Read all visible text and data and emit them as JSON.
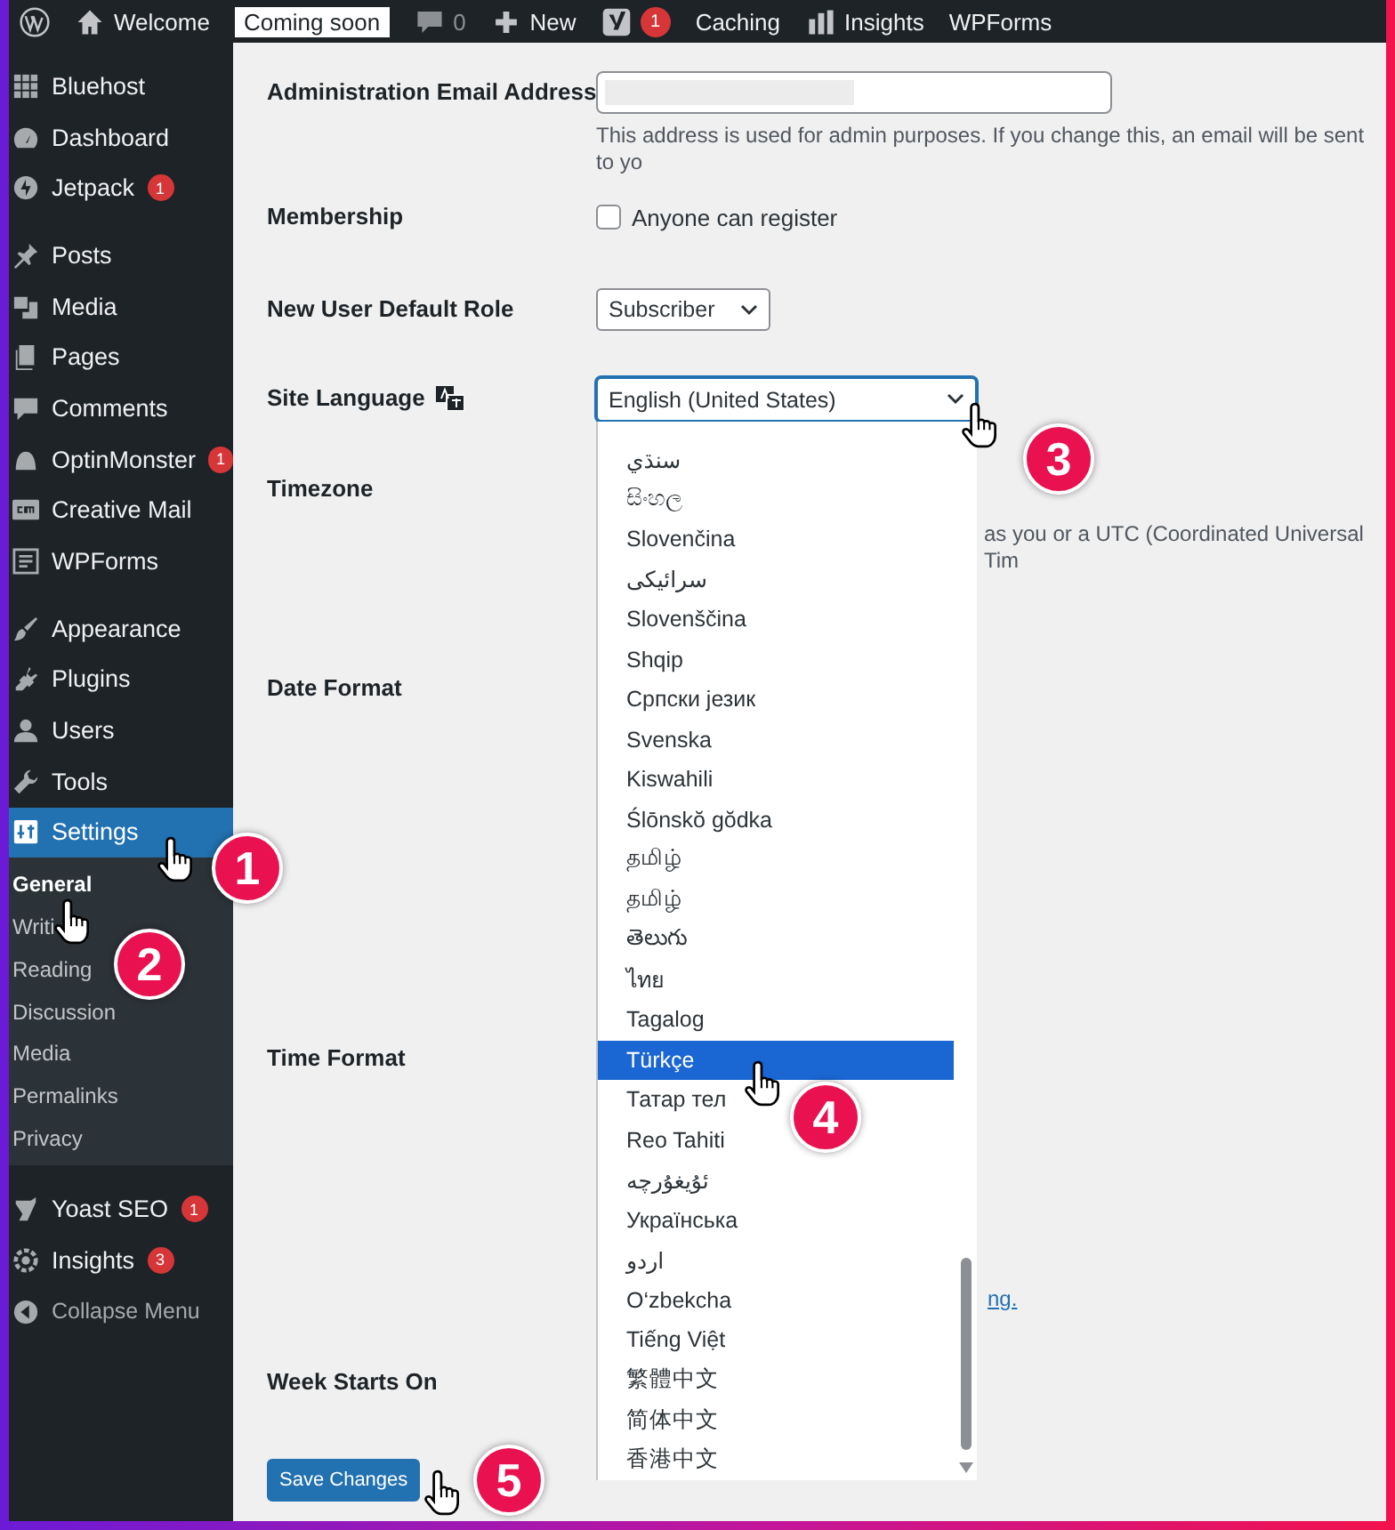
{
  "admin_bar": {
    "items": [
      {
        "kind": "logo"
      },
      {
        "kind": "site",
        "label": "Welcome"
      },
      {
        "kind": "badge",
        "label": "Coming soon"
      },
      {
        "kind": "comments",
        "label": "0"
      },
      {
        "kind": "new",
        "label": "New"
      },
      {
        "kind": "yoast",
        "badge": "1"
      },
      {
        "kind": "text",
        "label": "Caching"
      },
      {
        "kind": "insights",
        "label": "Insights"
      },
      {
        "kind": "text",
        "label": "WPForms"
      }
    ]
  },
  "sidebar": {
    "groups": [
      {
        "items": [
          {
            "label": "Bluehost",
            "kind": "grid",
            "selected": false
          },
          {
            "label": "Dashboard",
            "kind": "gauge",
            "selected": false
          },
          {
            "label": "Jetpack",
            "kind": "bolt",
            "badge": "1",
            "selected": false
          }
        ]
      },
      {
        "items": [
          {
            "label": "Posts",
            "kind": "pin",
            "selected": false
          },
          {
            "label": "Media",
            "kind": "media",
            "selected": false
          },
          {
            "label": "Pages",
            "kind": "pages",
            "selected": false
          },
          {
            "label": "Comments",
            "kind": "comment",
            "selected": false
          },
          {
            "label": "OptinMonster",
            "kind": "monster",
            "badge": "1",
            "selected": false
          },
          {
            "label": "Creative Mail",
            "kind": "cm",
            "selected": false
          },
          {
            "label": "WPForms",
            "kind": "forms",
            "selected": false
          }
        ]
      },
      {
        "items": [
          {
            "label": "Appearance",
            "kind": "brush",
            "selected": false
          },
          {
            "label": "Plugins",
            "kind": "plug",
            "selected": false
          },
          {
            "label": "Users",
            "kind": "user",
            "selected": false
          },
          {
            "label": "Tools",
            "kind": "wrench",
            "selected": false
          },
          {
            "label": "Settings",
            "kind": "settings",
            "selected": true,
            "submenu": [
              {
                "label": "General",
                "selected": true
              },
              {
                "label": "Writi",
                "selected": false
              },
              {
                "label": "Reading",
                "selected": false
              },
              {
                "label": "Discussion",
                "selected": false
              },
              {
                "label": "Media",
                "selected": false
              },
              {
                "label": "Permalinks",
                "selected": false
              },
              {
                "label": "Privacy",
                "selected": false
              }
            ]
          }
        ]
      },
      {
        "items": [
          {
            "label": "Yoast SEO",
            "kind": "yoast",
            "badge": "1",
            "selected": false
          },
          {
            "label": "Insights",
            "kind": "insights",
            "badge": "3",
            "selected": false
          },
          {
            "label": "Collapse Menu",
            "kind": "collapse",
            "selected": false
          }
        ]
      }
    ]
  },
  "form": {
    "rows": [
      {
        "label": "Administration Email Address",
        "kind": "email",
        "description": "This address is used for admin purposes. If you change this, an email will be sent to yo"
      },
      {
        "label": "Membership",
        "kind": "checkbox",
        "option": "Anyone can register",
        "checked": false
      },
      {
        "label": "New User Default Role",
        "kind": "select",
        "value": "Subscriber"
      },
      {
        "label": "Site Language",
        "kind": "language",
        "value": "English (United States)"
      },
      {
        "label": "Timezone",
        "kind": "note",
        "description": "as you or a UTC (Coordinated Universal Tim"
      },
      {
        "label": "Date Format",
        "kind": "blank"
      },
      {
        "label": "Time Format",
        "kind": "link",
        "link": "ng."
      },
      {
        "label": "Week Starts On",
        "kind": "blank"
      }
    ],
    "save_button": "Save Changes"
  },
  "language_dropdown": {
    "options": [
      {
        "label": "سنڌي",
        "selected": false
      },
      {
        "label": "සිංහල",
        "selected": false
      },
      {
        "label": "Slovenčina",
        "selected": false
      },
      {
        "label": "سرائیکی",
        "selected": false
      },
      {
        "label": "Slovenščina",
        "selected": false
      },
      {
        "label": "Shqip",
        "selected": false
      },
      {
        "label": "Српски језик",
        "selected": false
      },
      {
        "label": "Svenska",
        "selected": false
      },
      {
        "label": "Kiswahili",
        "selected": false
      },
      {
        "label": "Ślōnskŏ gŏdka",
        "selected": false
      },
      {
        "label": "தமிழ்",
        "selected": false
      },
      {
        "label": "தமிழ்",
        "selected": false
      },
      {
        "label": "తెలుగు",
        "selected": false
      },
      {
        "label": "ไทย",
        "selected": false
      },
      {
        "label": "Tagalog",
        "selected": false
      },
      {
        "label": "Türkçe",
        "selected": true
      },
      {
        "label": "Татар тел",
        "selected": false
      },
      {
        "label": "Reo Tahiti",
        "selected": false
      },
      {
        "label": "ئۇيغۇرچە",
        "selected": false
      },
      {
        "label": "Українська",
        "selected": false
      },
      {
        "label": "اردو",
        "selected": false
      },
      {
        "label": "O‘zbekcha",
        "selected": false
      },
      {
        "label": "Tiếng Việt",
        "selected": false
      },
      {
        "label": "繁體中文",
        "selected": false
      },
      {
        "label": "简体中文",
        "selected": false
      },
      {
        "label": "香港中文",
        "selected": false
      }
    ]
  },
  "callouts": [
    {
      "number": "1"
    },
    {
      "number": "2"
    },
    {
      "number": "3"
    },
    {
      "number": "4"
    },
    {
      "number": "5"
    }
  ]
}
